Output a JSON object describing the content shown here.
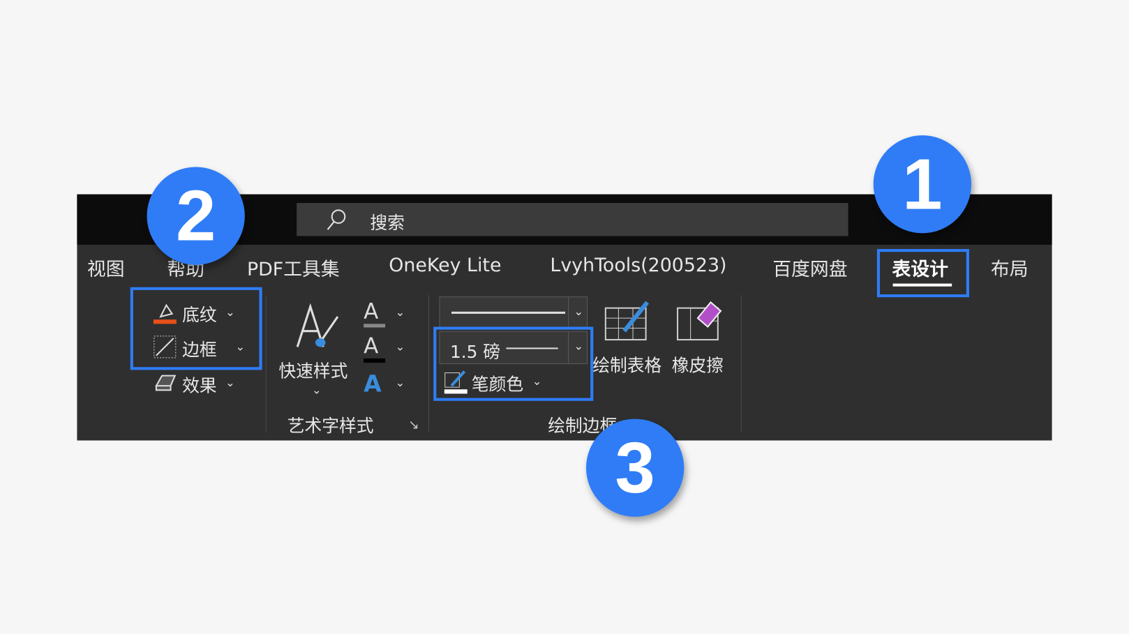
{
  "search": {
    "icon": "search-icon",
    "placeholder": "搜索"
  },
  "tabs": [
    {
      "label": "视图"
    },
    {
      "label": "帮助"
    },
    {
      "label": "PDF工具集"
    },
    {
      "label": "OneKey Lite"
    },
    {
      "label": "LvyhTools(200523)"
    },
    {
      "label": "百度网盘"
    },
    {
      "label": "表设计",
      "active": true
    },
    {
      "label": "布局"
    }
  ],
  "table_styles": {
    "shading": "底纹",
    "borders": "边框",
    "effects": "效果"
  },
  "wordart": {
    "quick_styles": "快速样式",
    "group_label": "艺术字样式"
  },
  "draw_borders": {
    "line_weight": "1.5 磅",
    "pen_color": "笔颜色",
    "draw_table": "绘制表格",
    "eraser": "橡皮擦",
    "group_label": "绘制边框"
  },
  "badges": [
    "1",
    "2",
    "3"
  ],
  "colors": {
    "highlight": "#2f7cf6",
    "shading_bar": "#e8501a",
    "ribbon": "#2f2f2f",
    "titlebar": "#0c0c0c"
  }
}
